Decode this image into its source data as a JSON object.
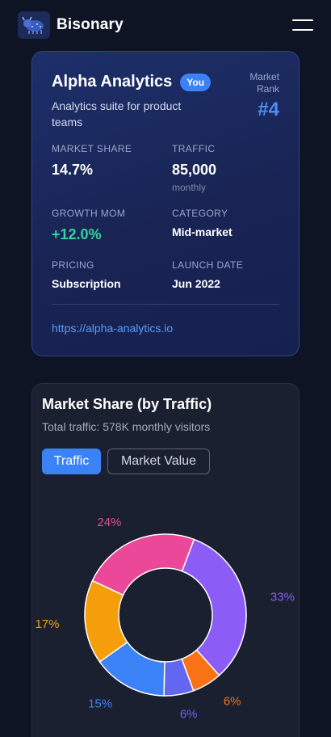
{
  "header": {
    "brand": "Bisonary",
    "logo_icon": "bison-logo-icon",
    "menu_icon": "hamburger-menu-icon"
  },
  "profile": {
    "name": "Alpha Analytics",
    "badge": "You",
    "description": "Analytics suite for product teams",
    "rank_label": "Market Rank",
    "rank_value": "#4",
    "stats": {
      "market_share_label": "MARKET SHARE",
      "market_share_value": "14.7%",
      "traffic_label": "TRAFFIC",
      "traffic_value": "85,000",
      "traffic_unit": "monthly",
      "growth_label": "GROWTH MOM",
      "growth_value": "+12.0%",
      "category_label": "CATEGORY",
      "category_value": "Mid-market",
      "pricing_label": "PRICING",
      "pricing_value": "Subscription",
      "launch_label": "LAUNCH DATE",
      "launch_value": "Jun 2022"
    },
    "url": "https://alpha-analytics.io"
  },
  "market_chart": {
    "title": "Market Share (by Traffic)",
    "subtitle": "Total traffic: 578K monthly visitors",
    "tabs": [
      "Traffic",
      "Market Value"
    ],
    "active_tab": "Traffic"
  },
  "chart_data": {
    "type": "pie",
    "title": "Market Share (by Traffic)",
    "slices": [
      {
        "label": "33%",
        "value": 33,
        "color": "#8b5cf6"
      },
      {
        "label": "6%",
        "value": 6,
        "color": "#f97316"
      },
      {
        "label": "6%",
        "value": 6,
        "color": "#6366f1"
      },
      {
        "label": "15%",
        "value": 15,
        "color": "#3b82f6"
      },
      {
        "label": "17%",
        "value": 17,
        "color": "#f59e0b"
      },
      {
        "label": "24%",
        "value": 24,
        "color": "#ec4899"
      }
    ]
  }
}
